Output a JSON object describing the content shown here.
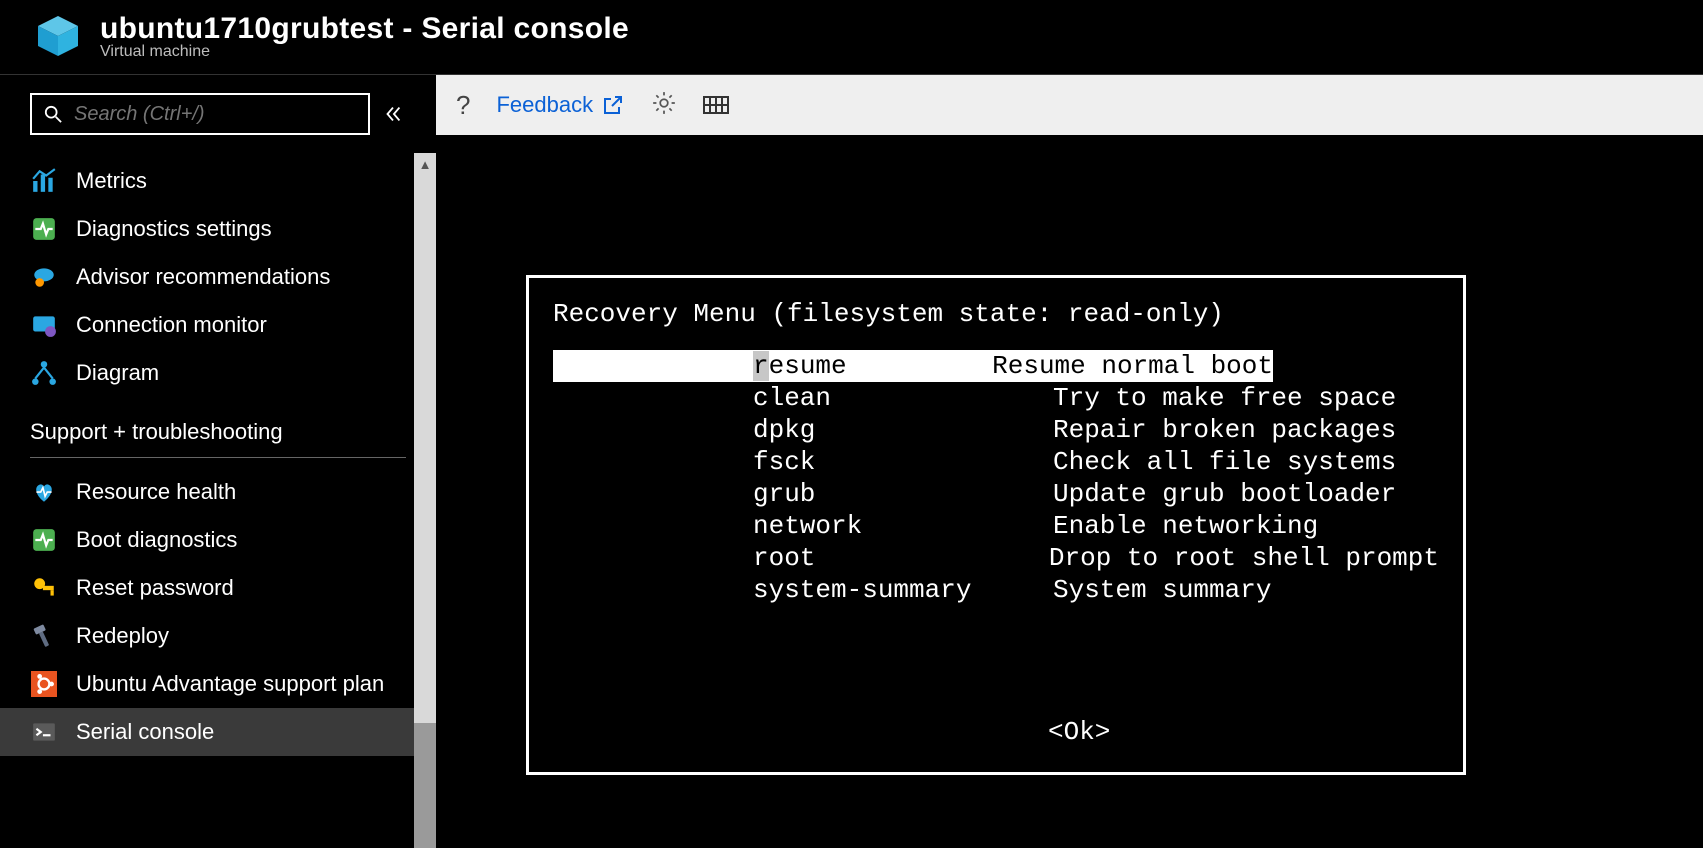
{
  "header": {
    "title": "ubuntu1710grubtest - Serial console",
    "subtitle": "Virtual machine"
  },
  "sidebar": {
    "search_placeholder": "Search (Ctrl+/)",
    "items_top": [
      {
        "label": "Metrics",
        "icon": "metrics"
      },
      {
        "label": "Diagnostics settings",
        "icon": "diag"
      },
      {
        "label": "Advisor recommendations",
        "icon": "advisor"
      },
      {
        "label": "Connection monitor",
        "icon": "conn"
      },
      {
        "label": "Diagram",
        "icon": "diagram"
      }
    ],
    "section_label": "Support + troubleshooting",
    "items_bottom": [
      {
        "label": "Resource health",
        "icon": "health"
      },
      {
        "label": "Boot diagnostics",
        "icon": "bootdiag"
      },
      {
        "label": "Reset password",
        "icon": "key"
      },
      {
        "label": "Redeploy",
        "icon": "hammer"
      },
      {
        "label": "Ubuntu Advantage support plan",
        "icon": "ubuntu"
      },
      {
        "label": "Serial console",
        "icon": "console",
        "active": true
      }
    ]
  },
  "toolbar": {
    "help_label": "?",
    "feedback_label": "Feedback"
  },
  "terminal": {
    "title": "Recovery Menu (filesystem state: read-only)",
    "rows": [
      {
        "key": "resume",
        "desc": "Resume normal boot",
        "selected": true
      },
      {
        "key": "clean",
        "desc": "Try to make free space"
      },
      {
        "key": "dpkg",
        "desc": "Repair broken packages"
      },
      {
        "key": "fsck",
        "desc": "Check all file systems"
      },
      {
        "key": "grub",
        "desc": "Update grub bootloader"
      },
      {
        "key": "network",
        "desc": "Enable networking"
      },
      {
        "key": "root",
        "desc": "Drop to root shell prompt"
      },
      {
        "key": "system-summary",
        "desc": "System summary"
      }
    ],
    "ok_label": "<Ok>"
  }
}
